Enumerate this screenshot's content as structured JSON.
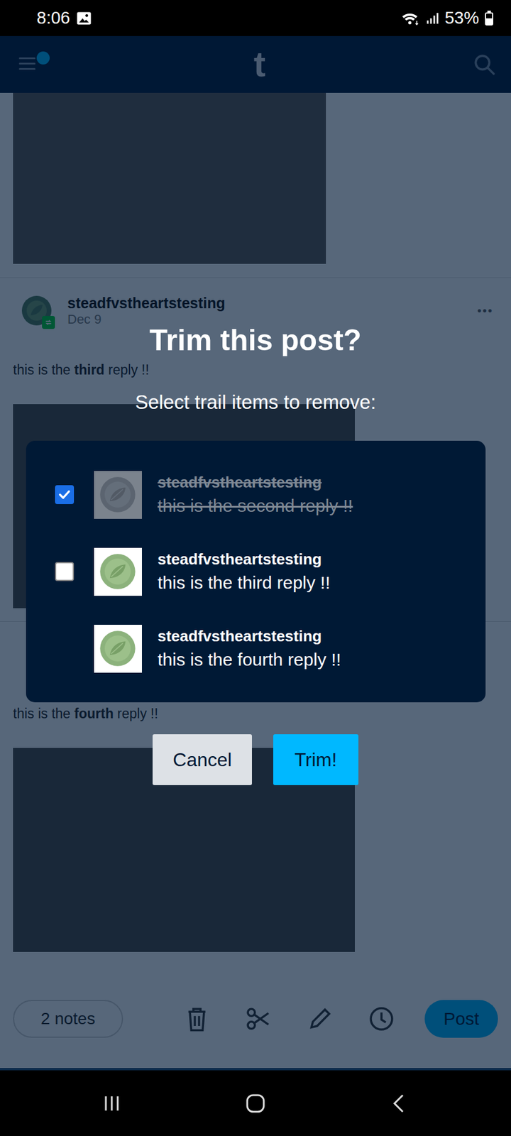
{
  "status_bar": {
    "time": "8:06",
    "battery": "53%",
    "battery_level": 0.53
  },
  "top_bar": {
    "logo": "t",
    "notification": true
  },
  "feed": [
    {
      "kind": "photo-only"
    },
    {
      "kind": "post",
      "author": "steadfvstheartstesting",
      "date": "Dec 9",
      "more": "•••",
      "reblogged": true,
      "text_parts": [
        {
          "text": "this is the ",
          "bold": false
        },
        {
          "text": "third",
          "bold": true
        },
        {
          "text": " reply !!",
          "bold": false
        }
      ]
    },
    {
      "kind": "post-hidden-header",
      "text_parts": [
        {
          "text": "this is the ",
          "bold": false
        },
        {
          "text": "fourth",
          "bold": true
        },
        {
          "text": " reply !!",
          "bold": false
        }
      ]
    }
  ],
  "bottom_bar": {
    "notes": "2 notes",
    "post": "Post"
  },
  "modal": {
    "title": "Trim this post?",
    "subtitle": "Select trail items to remove:",
    "items": [
      {
        "name": "steadfvstheartstesting",
        "text": "this is the second reply !!",
        "removable": true,
        "checked": true
      },
      {
        "name": "steadfvstheartstesting",
        "text": "this is the third reply !!",
        "removable": true,
        "checked": false
      },
      {
        "name": "steadfvstheartstesting",
        "text": "this is the fourth reply !!",
        "removable": false,
        "checked": false
      }
    ],
    "buttons": [
      {
        "label": "Cancel",
        "primary": false
      },
      {
        "label": "Trim!",
        "primary": true
      }
    ]
  }
}
